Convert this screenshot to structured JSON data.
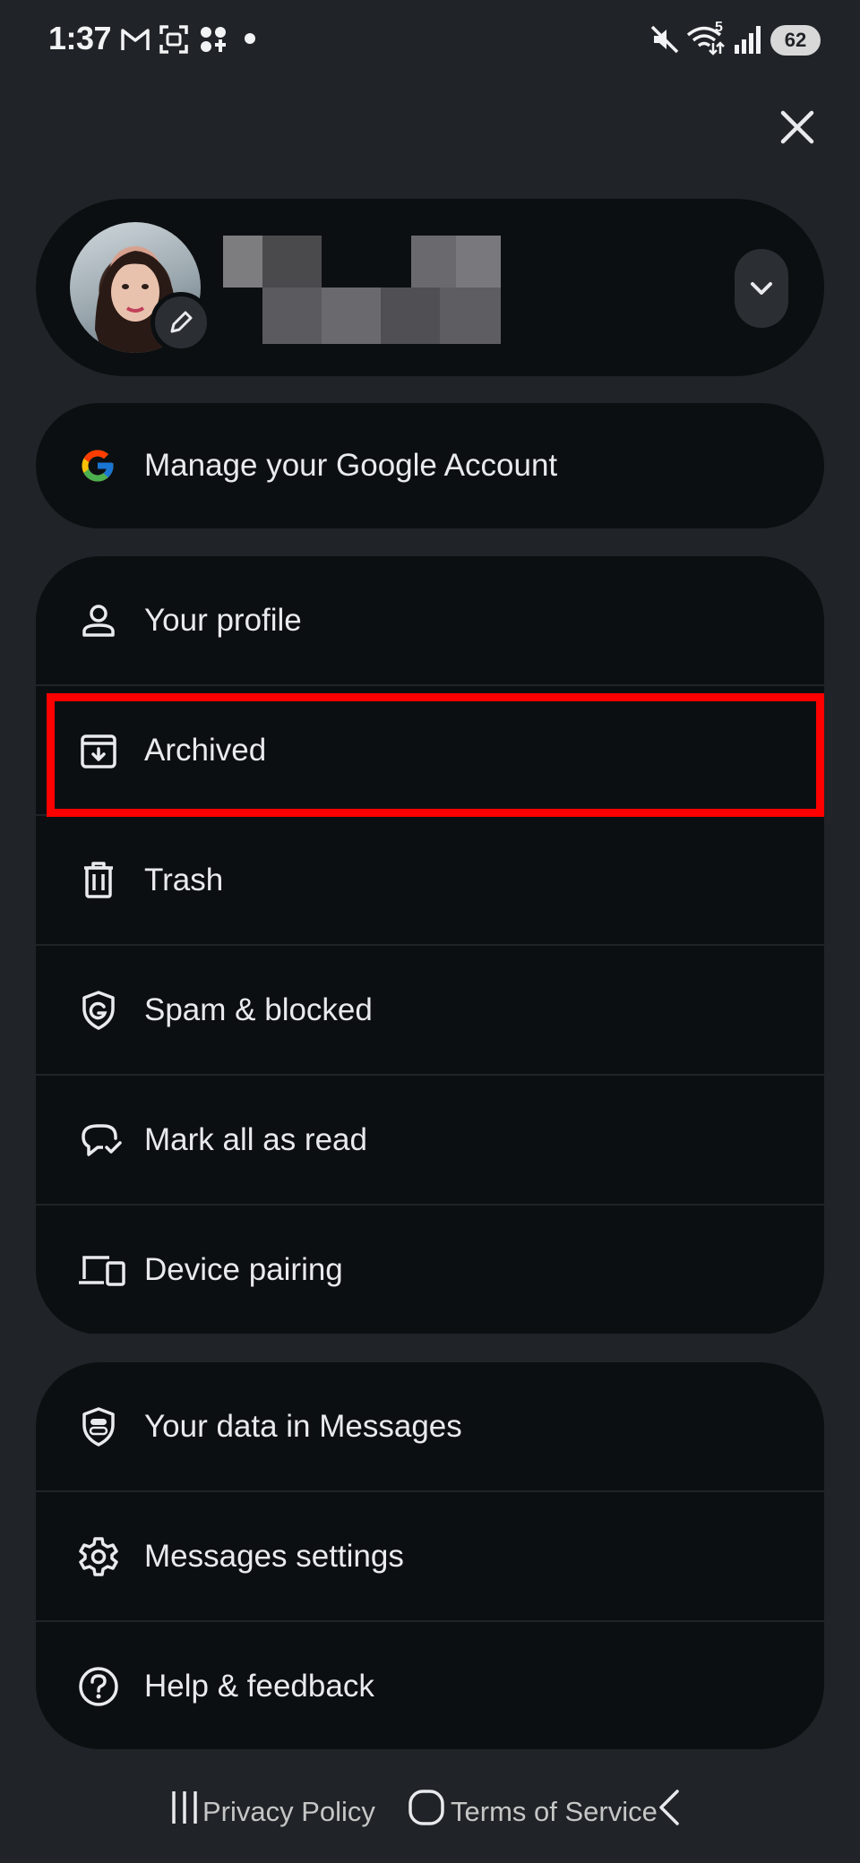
{
  "status_bar": {
    "time": "1:37",
    "battery": "62",
    "signal_extra": "5",
    "icons": [
      "gmail-icon",
      "screenshot-icon",
      "app-icon",
      "dot-icon",
      "mute-icon",
      "wifi-icon",
      "signal-icon",
      "battery-icon"
    ]
  },
  "close_label": "close-icon",
  "account": {
    "avatar_icon": "avatar",
    "edit_icon": "pencil-icon",
    "switch_icon": "chevron-down-icon"
  },
  "manage_account": {
    "label": "Manage your Google Account",
    "icon": "google-g-icon"
  },
  "menu_group_1": [
    {
      "label": "Your profile",
      "icon": "person-icon"
    },
    {
      "label": "Archived",
      "icon": "archive-icon",
      "highlighted": true
    },
    {
      "label": "Trash",
      "icon": "trash-icon"
    },
    {
      "label": "Spam & blocked",
      "icon": "shield-icon"
    },
    {
      "label": "Mark all as read",
      "icon": "chat-check-icon"
    },
    {
      "label": "Device pairing",
      "icon": "devices-icon"
    }
  ],
  "menu_group_2": [
    {
      "label": "Your data in Messages",
      "icon": "privacy-shield-icon"
    },
    {
      "label": "Messages settings",
      "icon": "gear-icon"
    },
    {
      "label": "Help & feedback",
      "icon": "help-icon"
    }
  ],
  "footer": {
    "privacy": "Privacy Policy",
    "terms": "Terms of Service"
  },
  "colors": {
    "background": "#202327",
    "card": "#0c0f12",
    "highlight": "#ff0000",
    "text": "#e8eaed"
  }
}
